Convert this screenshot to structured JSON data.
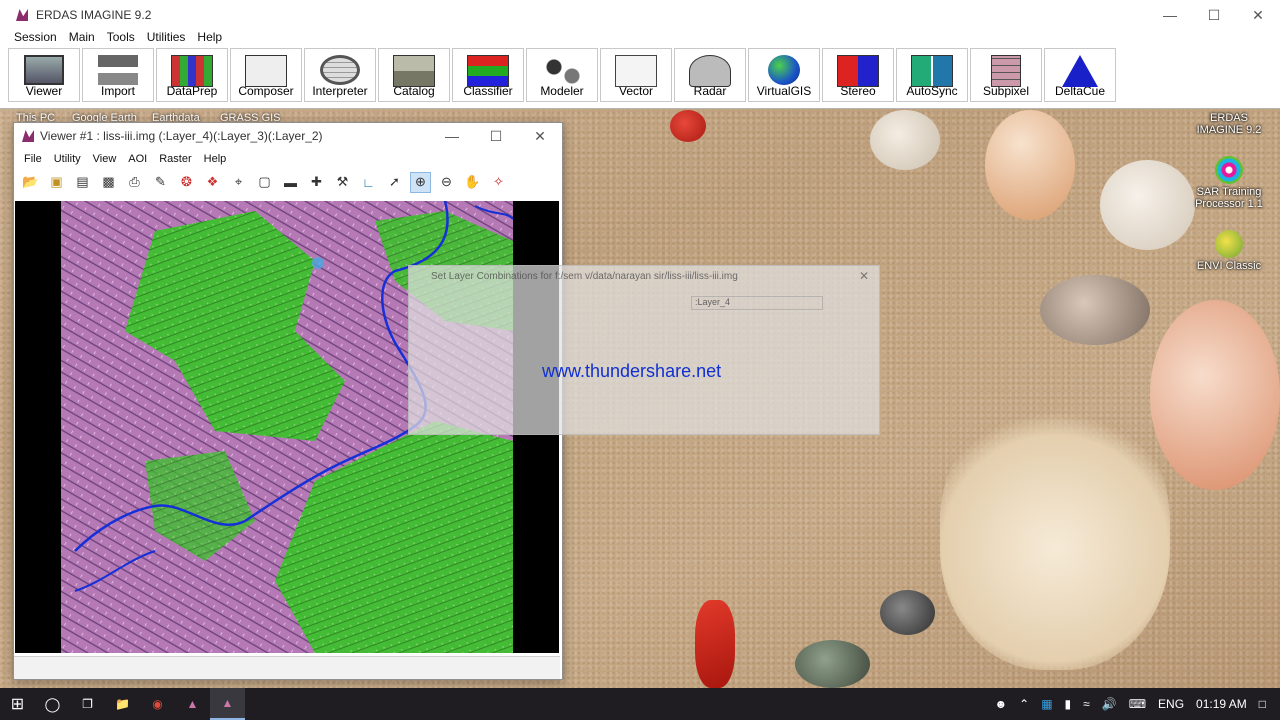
{
  "erdas": {
    "title": "ERDAS IMAGINE 9.2",
    "menu": [
      "Session",
      "Main",
      "Tools",
      "Utilities",
      "Help"
    ],
    "toolbar": [
      "Viewer",
      "Import",
      "DataPrep",
      "Composer",
      "Interpreter",
      "Catalog",
      "Classifier",
      "Modeler",
      "Vector",
      "Radar",
      "VirtualGIS",
      "Stereo",
      "AutoSync",
      "Subpixel",
      "DeltaCue"
    ]
  },
  "viewer": {
    "title": "Viewer #1 : liss-iii.img (:Layer_4)(:Layer_3)(:Layer_2)",
    "menu": [
      "File",
      "Utility",
      "View",
      "AOI",
      "Raster",
      "Help"
    ]
  },
  "dialog": {
    "title": "Set Layer Combinations for f:/sem v/data/narayan sir/liss-iii/liss-iii.img",
    "layer_value": ":Layer_4"
  },
  "watermark": "www.thundershare.net",
  "desktop": {
    "top_labels": [
      "This PC",
      "Google Earth",
      "Earthdata",
      "GRASS GIS"
    ],
    "right_icons": [
      "ERDAS IMAGINE 9.2",
      "SAR Training Processor 1.1",
      "ENVI Classic"
    ]
  },
  "taskbar": {
    "language": "ENG",
    "time": "01:19 AM"
  },
  "colors": {
    "title_text": "#333333",
    "watermark": "#1030d0",
    "vegetation": "#3fbf2f",
    "terrain": "#b57ab5",
    "river": "#1530d8",
    "taskbar": "#1f1d22"
  }
}
